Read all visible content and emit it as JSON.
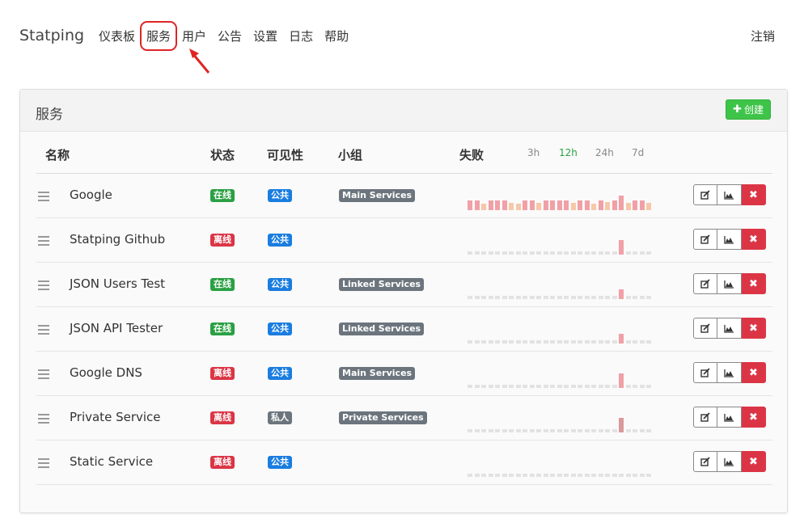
{
  "nav": {
    "brand": "Statping",
    "items": [
      "仪表板",
      "服务",
      "用户",
      "公告",
      "设置",
      "日志",
      "帮助"
    ],
    "active_index": 1,
    "logout": "注销"
  },
  "card": {
    "title": "服务",
    "create_label": "创建"
  },
  "table": {
    "headers": {
      "name": "名称",
      "status": "状态",
      "visibility": "可见性",
      "group": "小组",
      "failures": "失败"
    },
    "ranges": [
      "3h",
      "12h",
      "24h",
      "7d"
    ],
    "active_range": "12h"
  },
  "colors": {
    "online": "#2aa043",
    "offline": "#db3545",
    "public": "#1a7de0",
    "muted": "#6c757d",
    "create": "#3ec449",
    "highlight": "#e02424"
  },
  "rows": [
    {
      "name": "Google",
      "status": "在线",
      "online": true,
      "visibility": "公共",
      "public": true,
      "group": "Main Services",
      "spark": [
        18,
        18,
        10,
        18,
        18,
        18,
        12,
        10,
        18,
        18,
        12,
        18,
        18,
        18,
        18,
        12,
        18,
        18,
        10,
        18,
        14,
        18,
        30,
        12,
        18,
        18,
        12
      ]
    },
    {
      "name": "Statping Github",
      "status": "离线",
      "online": false,
      "visibility": "公共",
      "public": true,
      "group": "",
      "spark": [
        0,
        0,
        0,
        0,
        0,
        0,
        0,
        0,
        0,
        0,
        0,
        0,
        0,
        0,
        0,
        0,
        0,
        0,
        0,
        0,
        0,
        0,
        30,
        0,
        0,
        0,
        0
      ]
    },
    {
      "name": "JSON Users Test",
      "status": "在线",
      "online": true,
      "visibility": "公共",
      "public": true,
      "group": "Linked Services",
      "spark": [
        0,
        0,
        0,
        0,
        0,
        0,
        0,
        0,
        0,
        0,
        0,
        0,
        0,
        0,
        0,
        0,
        0,
        0,
        0,
        0,
        0,
        0,
        18,
        0,
        0,
        0,
        0
      ]
    },
    {
      "name": "JSON API Tester",
      "status": "在线",
      "online": true,
      "visibility": "公共",
      "public": true,
      "group": "Linked Services",
      "spark": [
        0,
        0,
        0,
        0,
        0,
        0,
        0,
        0,
        0,
        0,
        0,
        0,
        0,
        0,
        0,
        0,
        0,
        0,
        0,
        0,
        0,
        0,
        18,
        0,
        0,
        0,
        0
      ]
    },
    {
      "name": "Google DNS",
      "status": "离线",
      "online": false,
      "visibility": "公共",
      "public": true,
      "group": "Main Services",
      "spark": [
        0,
        0,
        0,
        0,
        0,
        0,
        0,
        0,
        0,
        0,
        0,
        0,
        0,
        0,
        0,
        0,
        0,
        0,
        0,
        0,
        0,
        0,
        30,
        0,
        0,
        0,
        0
      ]
    },
    {
      "name": "Private Service",
      "status": "离线",
      "online": false,
      "visibility": "私人",
      "public": false,
      "group": "Private Services",
      "spark": [
        0,
        0,
        0,
        0,
        0,
        0,
        0,
        0,
        0,
        0,
        0,
        0,
        0,
        0,
        0,
        0,
        0,
        0,
        0,
        0,
        0,
        0,
        30,
        0,
        0,
        0,
        0
      ]
    },
    {
      "name": "Static Service",
      "status": "离线",
      "online": false,
      "visibility": "公共",
      "public": true,
      "group": "",
      "spark": [
        0,
        0,
        0,
        0,
        0,
        0,
        0,
        0,
        0,
        0,
        0,
        0,
        0,
        0,
        0,
        0,
        0,
        0,
        0,
        0,
        0,
        0,
        0,
        0,
        0,
        0,
        0
      ]
    }
  ]
}
